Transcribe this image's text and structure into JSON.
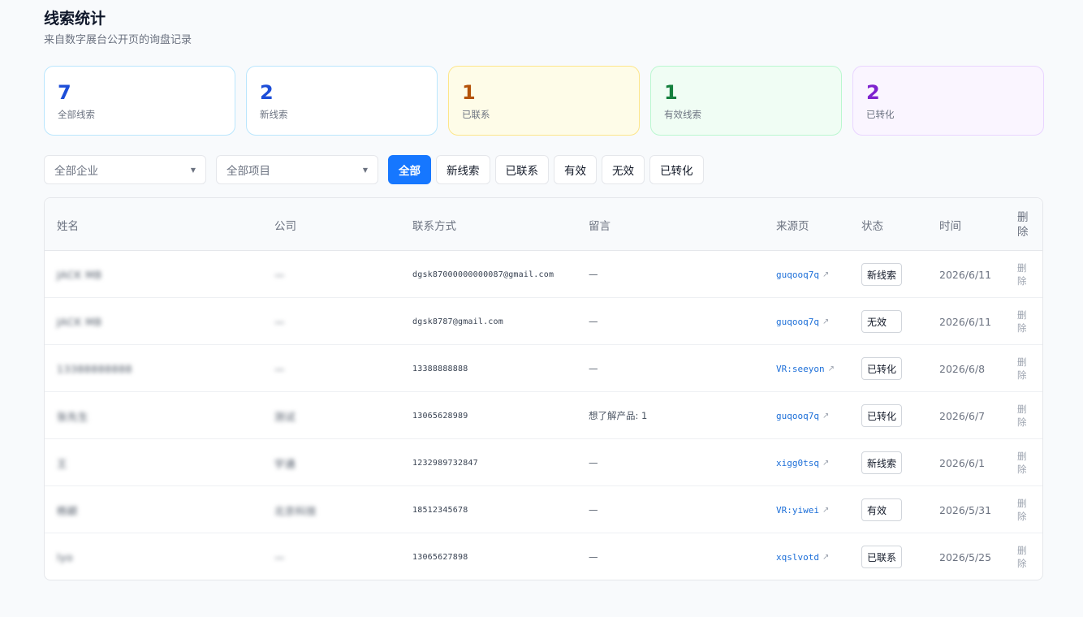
{
  "page": {
    "title": "线索统计",
    "subtitle": "来自数字展台公开页的询盘记录"
  },
  "stats": [
    {
      "value": "7",
      "label": "全部线索",
      "color": "#1d4ed8",
      "bg": "#ffffff",
      "border": "#bae6fd"
    },
    {
      "value": "2",
      "label": "新线索",
      "color": "#1d4ed8",
      "bg": "#ffffff",
      "border": "#bae6fd"
    },
    {
      "value": "1",
      "label": "已联系",
      "color": "#b45309",
      "bg": "#fefce8",
      "border": "#fde68a"
    },
    {
      "value": "1",
      "label": "有效线索",
      "color": "#15803d",
      "bg": "#f0fdf4",
      "border": "#bbf7d0"
    },
    {
      "value": "2",
      "label": "已转化",
      "color": "#7e22ce",
      "bg": "#faf5ff",
      "border": "#e9d5ff"
    }
  ],
  "filters": {
    "company_select": "全部企业",
    "project_select": "全部项目",
    "status_buttons": [
      "全部",
      "新线索",
      "已联系",
      "有效",
      "无效",
      "已转化"
    ],
    "active_index": 0
  },
  "table": {
    "headers": {
      "name": "姓名",
      "company": "公司",
      "contact": "联系方式",
      "message": "留言",
      "source": "来源页",
      "status": "状态",
      "time": "时间",
      "delete": "删除"
    },
    "rows": [
      {
        "name": "JACK MB",
        "company": "—",
        "contact": "dgsk87000000000087@gmail.com",
        "message": "—",
        "source": "guqooq7q",
        "status": "新线索",
        "time": "2026/6/11",
        "delete": "删除"
      },
      {
        "name": "JACK MB",
        "company": "—",
        "contact": "dgsk8787@gmail.com",
        "message": "—",
        "source": "guqooq7q",
        "status": "无效",
        "time": "2026/6/11",
        "delete": "删除"
      },
      {
        "name": "13388888888",
        "company": "—",
        "contact": "13388888888",
        "message": "—",
        "source": "VR:seeyon",
        "status": "已转化",
        "time": "2026/6/8",
        "delete": "删除"
      },
      {
        "name": "张先生",
        "company": "测试",
        "contact": "13065628989",
        "message": "想了解产品: 1",
        "source": "guqooq7q",
        "status": "已转化",
        "time": "2026/6/7",
        "delete": "删除"
      },
      {
        "name": "王",
        "company": "宇通",
        "contact": "1232989732847",
        "message": "—",
        "source": "xigg0tsq",
        "status": "新线索",
        "time": "2026/6/1",
        "delete": "删除"
      },
      {
        "name": "杨颖",
        "company": "北京科技",
        "contact": "18512345678",
        "message": "—",
        "source": "VR:yiwei",
        "status": "有效",
        "time": "2026/5/31",
        "delete": "删除"
      },
      {
        "name": "lyo",
        "company": "—",
        "contact": "13065627898",
        "message": "—",
        "source": "xqslvotd",
        "status": "已联系",
        "time": "2026/5/25",
        "delete": "删除"
      }
    ]
  },
  "icons": {
    "dropdown": "caret-down-icon",
    "external_link": "external-link-icon"
  },
  "colors": {
    "primary": "#1677ff",
    "link": "#1d6fd8"
  }
}
